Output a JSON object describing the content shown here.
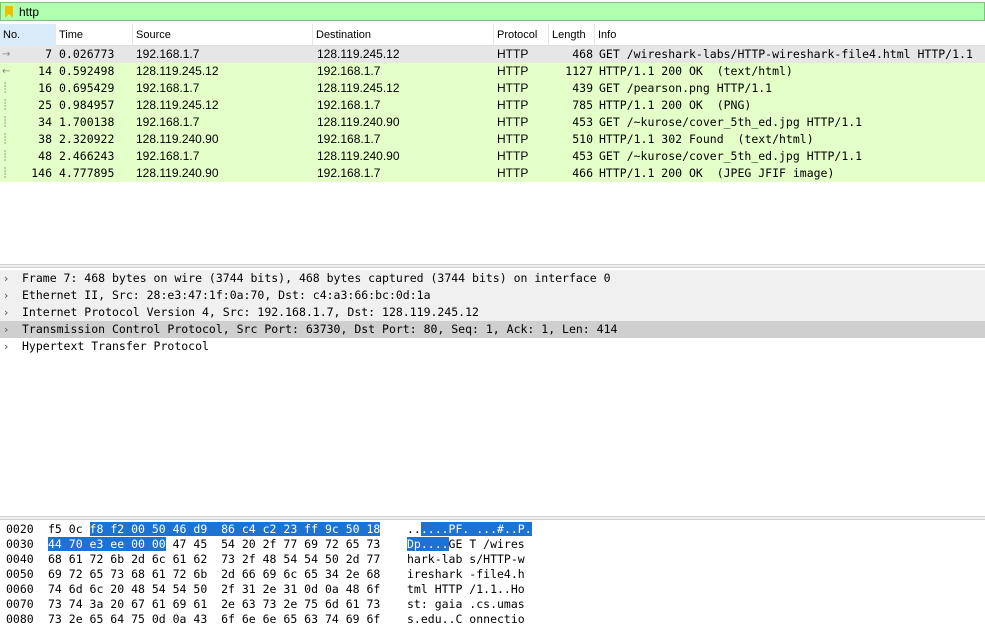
{
  "filter": {
    "value": "http"
  },
  "columns": [
    "No.",
    "Time",
    "Source",
    "Destination",
    "Protocol",
    "Length",
    "Info"
  ],
  "packets": [
    {
      "no": "7",
      "time": "0.026773",
      "src": "192.168.1.7",
      "dst": "128.119.245.12",
      "proto": "HTTP",
      "len": "468",
      "info": "GET /wireshark-labs/HTTP-wireshark-file4.html HTTP/1.1"
    },
    {
      "no": "14",
      "time": "0.592498",
      "src": "128.119.245.12",
      "dst": "192.168.1.7",
      "proto": "HTTP",
      "len": "1127",
      "info": "HTTP/1.1 200 OK  (text/html)"
    },
    {
      "no": "16",
      "time": "0.695429",
      "src": "192.168.1.7",
      "dst": "128.119.245.12",
      "proto": "HTTP",
      "len": "439",
      "info": "GET /pearson.png HTTP/1.1"
    },
    {
      "no": "25",
      "time": "0.984957",
      "src": "128.119.245.12",
      "dst": "192.168.1.7",
      "proto": "HTTP",
      "len": "785",
      "info": "HTTP/1.1 200 OK  (PNG)"
    },
    {
      "no": "34",
      "time": "1.700138",
      "src": "192.168.1.7",
      "dst": "128.119.240.90",
      "proto": "HTTP",
      "len": "453",
      "info": "GET /~kurose/cover_5th_ed.jpg HTTP/1.1"
    },
    {
      "no": "38",
      "time": "2.320922",
      "src": "128.119.240.90",
      "dst": "192.168.1.7",
      "proto": "HTTP",
      "len": "510",
      "info": "HTTP/1.1 302 Found  (text/html)"
    },
    {
      "no": "48",
      "time": "2.466243",
      "src": "192.168.1.7",
      "dst": "128.119.240.90",
      "proto": "HTTP",
      "len": "453",
      "info": "GET /~kurose/cover_5th_ed.jpg HTTP/1.1"
    },
    {
      "no": "146",
      "time": "4.777895",
      "src": "128.119.240.90",
      "dst": "192.168.1.7",
      "proto": "HTTP",
      "len": "466",
      "info": "HTTP/1.1 200 OK  (JPEG JFIF image)"
    }
  ],
  "details": [
    {
      "label": "Frame 7: 468 bytes on wire (3744 bits), 468 bytes captured (3744 bits) on interface 0",
      "style": "grey"
    },
    {
      "label": "Ethernet II, Src: 28:e3:47:1f:0a:70, Dst: c4:a3:66:bc:0d:1a",
      "style": "grey"
    },
    {
      "label": "Internet Protocol Version 4, Src: 192.168.1.7, Dst: 128.119.245.12",
      "style": "grey"
    },
    {
      "label": "Transmission Control Protocol, Src Port: 63730, Dst Port: 80, Seq: 1, Ack: 1, Len: 414",
      "style": "dark"
    },
    {
      "label": "Hypertext Transfer Protocol",
      "style": "sel"
    }
  ],
  "bytes": [
    {
      "off": "0020",
      "hex_plain": "f5 0c ",
      "hex_hl": "f8 f2 00 50 46 d9  86 c4 c2 23 ff 9c 50 18",
      "hex_rest": "",
      "asc_plain": "..",
      "asc_hl": "....PF. ...#..P.",
      "asc_rest": ""
    },
    {
      "off": "0030",
      "hex_plain": "",
      "hex_hl": "44 70 e3 ee 00 00",
      "hex_rest": " 47 45  54 20 2f 77 69 72 65 73",
      "asc_plain": "",
      "asc_hl": "Dp....",
      "asc_rest": "GE T /wires"
    },
    {
      "off": "0040",
      "hex_plain": "68 61 72 6b 2d 6c 61 62  73 2f 48 54 54 50 2d 77",
      "hex_hl": "",
      "hex_rest": "",
      "asc_plain": "hark-lab s/HTTP-w",
      "asc_hl": "",
      "asc_rest": ""
    },
    {
      "off": "0050",
      "hex_plain": "69 72 65 73 68 61 72 6b  2d 66 69 6c 65 34 2e 68",
      "hex_hl": "",
      "hex_rest": "",
      "asc_plain": "ireshark -file4.h",
      "asc_hl": "",
      "asc_rest": ""
    },
    {
      "off": "0060",
      "hex_plain": "74 6d 6c 20 48 54 54 50  2f 31 2e 31 0d 0a 48 6f",
      "hex_hl": "",
      "hex_rest": "",
      "asc_plain": "tml HTTP /1.1..Ho",
      "asc_hl": "",
      "asc_rest": ""
    },
    {
      "off": "0070",
      "hex_plain": "73 74 3a 20 67 61 69 61  2e 63 73 2e 75 6d 61 73",
      "hex_hl": "",
      "hex_rest": "",
      "asc_plain": "st: gaia .cs.umas",
      "asc_hl": "",
      "asc_rest": ""
    },
    {
      "off": "0080",
      "hex_plain": "73 2e 65 64 75 0d 0a 43  6f 6e 6e 65 63 74 69 6f",
      "hex_hl": "",
      "hex_rest": "",
      "asc_plain": "s.edu..C onnectio",
      "asc_hl": "",
      "asc_rest": ""
    }
  ],
  "colors": {
    "http_row": "#e4ffc7",
    "selected_row": "#e6e6e6",
    "filter_ok": "#afffaf",
    "tree_selected": "#7eb3f0",
    "byte_highlight": "#1e73d2"
  },
  "icons": {
    "filter": "bookmark-icon",
    "tree_expand": "chevron-right-icon",
    "relation": "related-packet-icon"
  }
}
